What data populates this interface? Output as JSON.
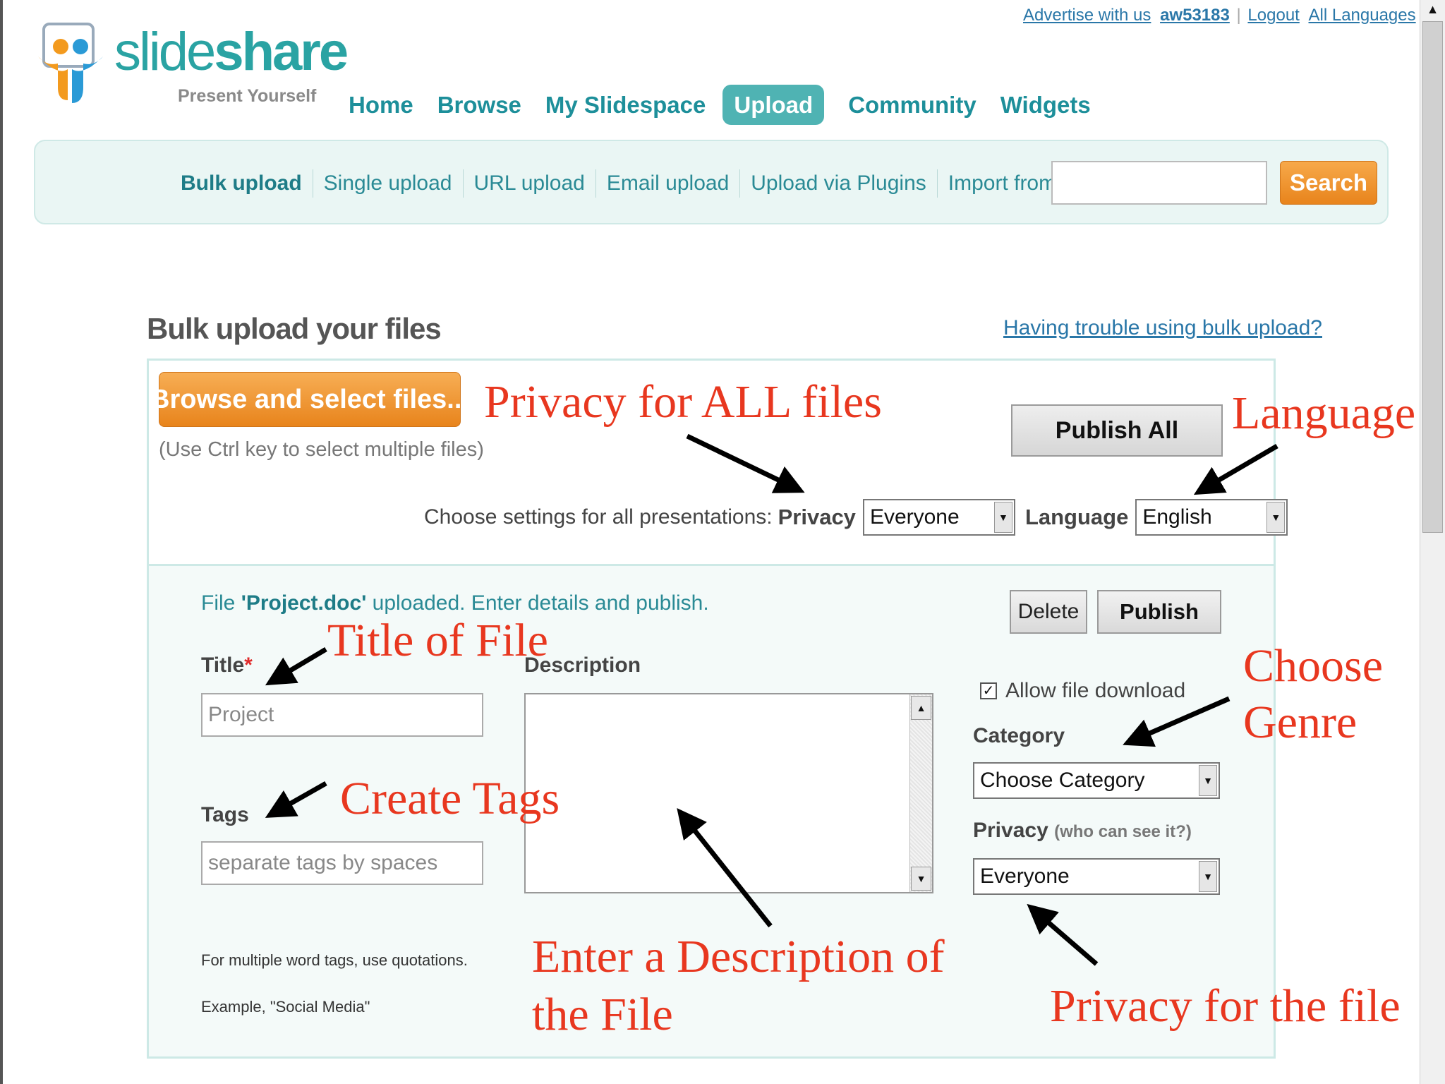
{
  "top_links": {
    "advertise": "Advertise with us",
    "username": "aw53183",
    "logout": "Logout",
    "languages": "All Languages"
  },
  "logo": {
    "word_light": "slide",
    "word_bold": "share",
    "tagline": "Present Yourself"
  },
  "nav": {
    "items": [
      "Home",
      "Browse",
      "My Slidespace",
      "Upload",
      "Community",
      "Widgets"
    ],
    "active": "Upload"
  },
  "sub_nav": {
    "items": [
      "Bulk upload",
      "Single upload",
      "URL upload",
      "Email upload",
      "Upload via Plugins",
      "Import from Google Docs"
    ],
    "search_button": "Search",
    "search_value": ""
  },
  "page": {
    "title": "Bulk upload your files",
    "help_link": "Having trouble using bulk upload?"
  },
  "global_settings": {
    "browse_button": "Browse and select files...",
    "browse_hint": "(Use Ctrl key to select multiple files)",
    "publish_all": "Publish All",
    "settings_text": "Choose settings for all presentations:",
    "privacy_label": "Privacy",
    "privacy_value": "Everyone",
    "language_label": "Language",
    "language_value": "English"
  },
  "file": {
    "status_pre": "File ",
    "status_name": "'Project.doc'",
    "status_post": " uploaded. Enter details and publish.",
    "delete_button": "Delete",
    "publish_button": "Publish",
    "title_label": "Title",
    "required_mark": "*",
    "title_value": "Project",
    "description_label": "Description",
    "description_value": "",
    "tags_label": "Tags",
    "tags_placeholder": "separate tags by spaces",
    "tags_hint_1": "For multiple word tags, use quotations.",
    "tags_hint_2": "Example, \"Social Media\"",
    "allow_download_label": "Allow file download",
    "allow_download_checked": true,
    "category_label": "Category",
    "category_value": "Choose Category",
    "privacy_label": "Privacy",
    "privacy_sub": "(who can see it?)",
    "privacy_value": "Everyone"
  },
  "annotations": {
    "privacy_all": "Privacy for ALL files",
    "language": "Language",
    "title_of_file": "Title of File",
    "choose_genre_1": "Choose",
    "choose_genre_2": "Genre",
    "create_tags": "Create Tags",
    "description_1": "Enter a Description of",
    "description_2": "the File",
    "privacy_file": "Privacy for the file"
  },
  "colors": {
    "teal": "#2aa3a3",
    "nav_active_bg": "#4fb3b3",
    "orange": "#e8841c",
    "annotation_red": "#e8371f",
    "link_blue": "#2a77a8"
  },
  "icons": {
    "dropdown": "triangle-down",
    "scroll_up": "triangle-up",
    "checkbox": "check-mark"
  }
}
